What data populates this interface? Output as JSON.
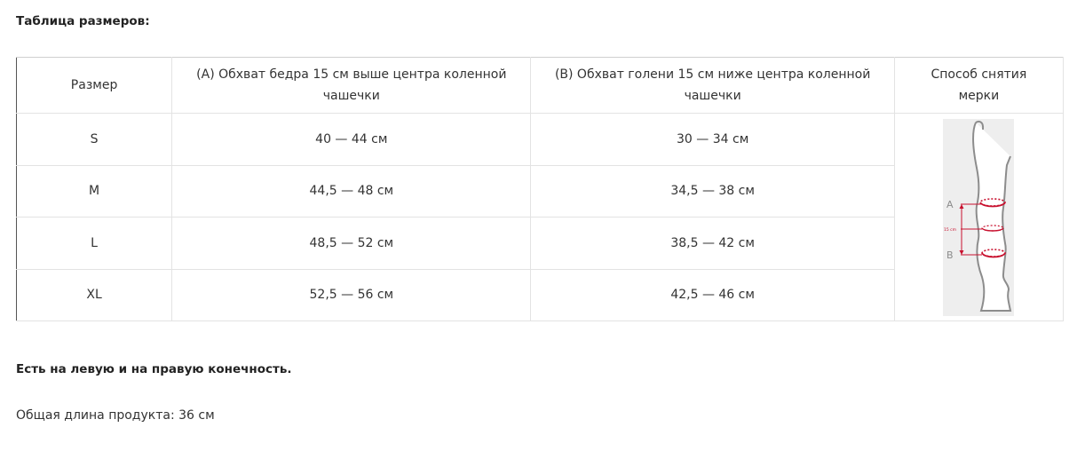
{
  "heading": "Таблица размеров:",
  "table": {
    "headers": {
      "size": "Размер",
      "a": "(A) Обхват бедра 15 см выше центра коленной чашечки",
      "b": "(B) Обхват голени 15 см ниже центра коленной чашечки",
      "method": "Способ снятия мерки"
    },
    "rows": [
      {
        "size": "S",
        "a": "40 — 44 см",
        "b": "30 — 34 см"
      },
      {
        "size": "M",
        "a": "44,5 — 48 см",
        "b": "34,5 — 38 см"
      },
      {
        "size": "L",
        "a": "48,5 — 52 см",
        "b": "38,5 — 42 см"
      },
      {
        "size": "XL",
        "a": "52,5 — 56 см",
        "b": "42,5 — 46 см"
      }
    ],
    "figure": {
      "label_a": "A",
      "label_b": "B",
      "label_distance": "15 cm",
      "accent_color": "#c8102e"
    }
  },
  "note": "Есть на левую и на правую конечность.",
  "length": {
    "label": "Общая длина продукта:",
    "value": "36 см"
  }
}
